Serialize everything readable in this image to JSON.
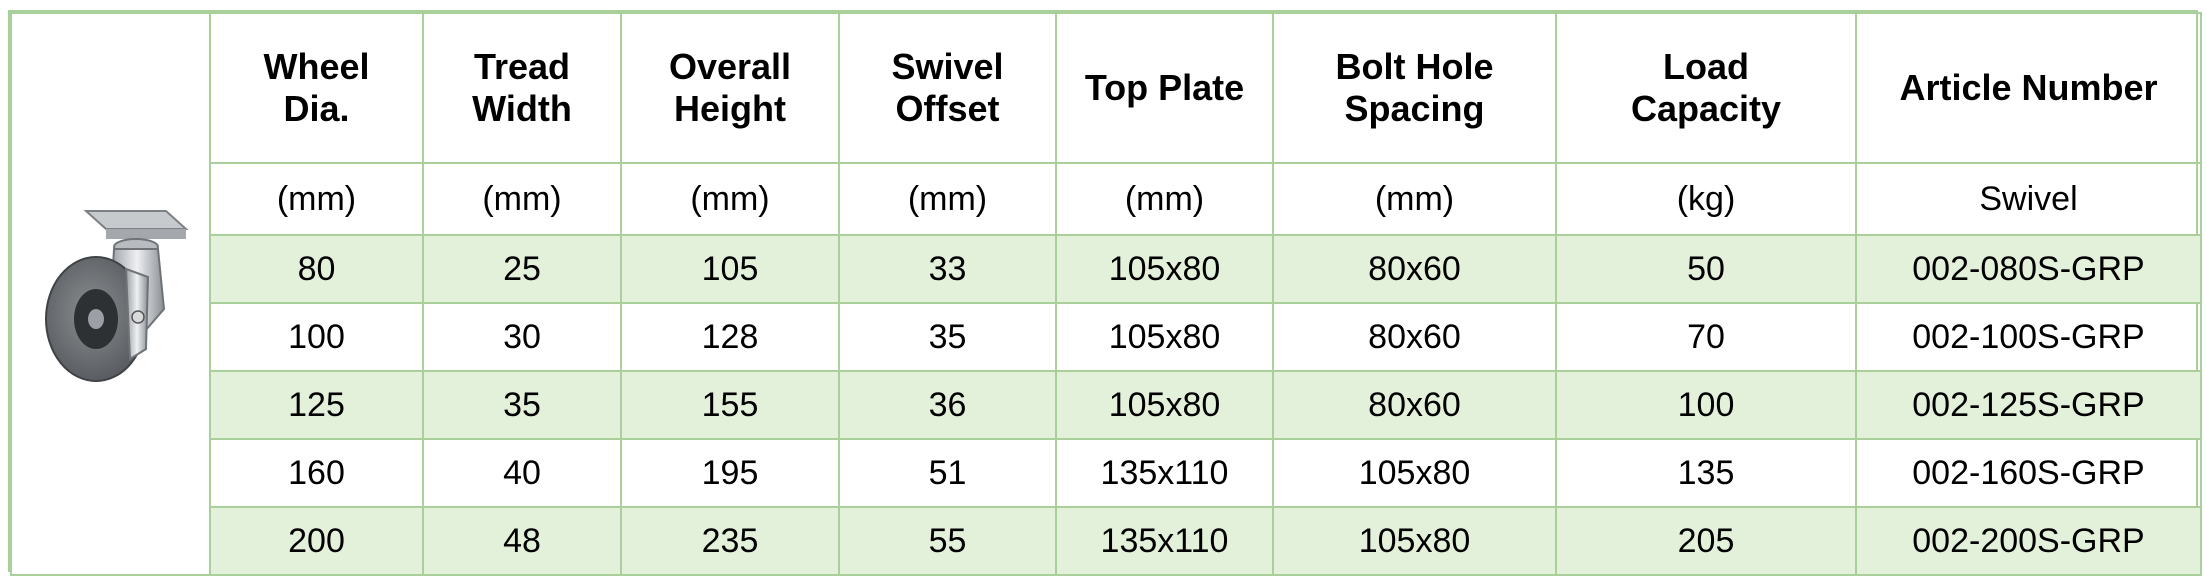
{
  "headers": [
    {
      "line1": "Wheel",
      "line2": "Dia."
    },
    {
      "line1": "Tread",
      "line2": "Width"
    },
    {
      "line1": "Overall",
      "line2": "Height"
    },
    {
      "line1": "Swivel",
      "line2": "Offset"
    },
    {
      "line1": "Top Plate",
      "line2": ""
    },
    {
      "line1": "Bolt Hole",
      "line2": "Spacing"
    },
    {
      "line1": "Load",
      "line2": "Capacity"
    },
    {
      "line1": "Article Number",
      "line2": ""
    }
  ],
  "units": [
    "(mm)",
    "(mm)",
    "(mm)",
    "(mm)",
    "(mm)",
    "(mm)",
    "(kg)",
    "Swivel"
  ],
  "rows": [
    [
      "80",
      "25",
      "105",
      "33",
      "105x80",
      "80x60",
      "50",
      "002-080S-GRP"
    ],
    [
      "100",
      "30",
      "128",
      "35",
      "105x80",
      "80x60",
      "70",
      "002-100S-GRP"
    ],
    [
      "125",
      "35",
      "155",
      "36",
      "105x80",
      "80x60",
      "100",
      "002-125S-GRP"
    ],
    [
      "160",
      "40",
      "195",
      "51",
      "135x110",
      "105x80",
      "135",
      "002-160S-GRP"
    ],
    [
      "200",
      "48",
      "235",
      "55",
      "135x110",
      "105x80",
      "205",
      "002-200S-GRP"
    ]
  ],
  "colors": {
    "border": "#a9cf9b",
    "shade": "#e4f1da"
  }
}
